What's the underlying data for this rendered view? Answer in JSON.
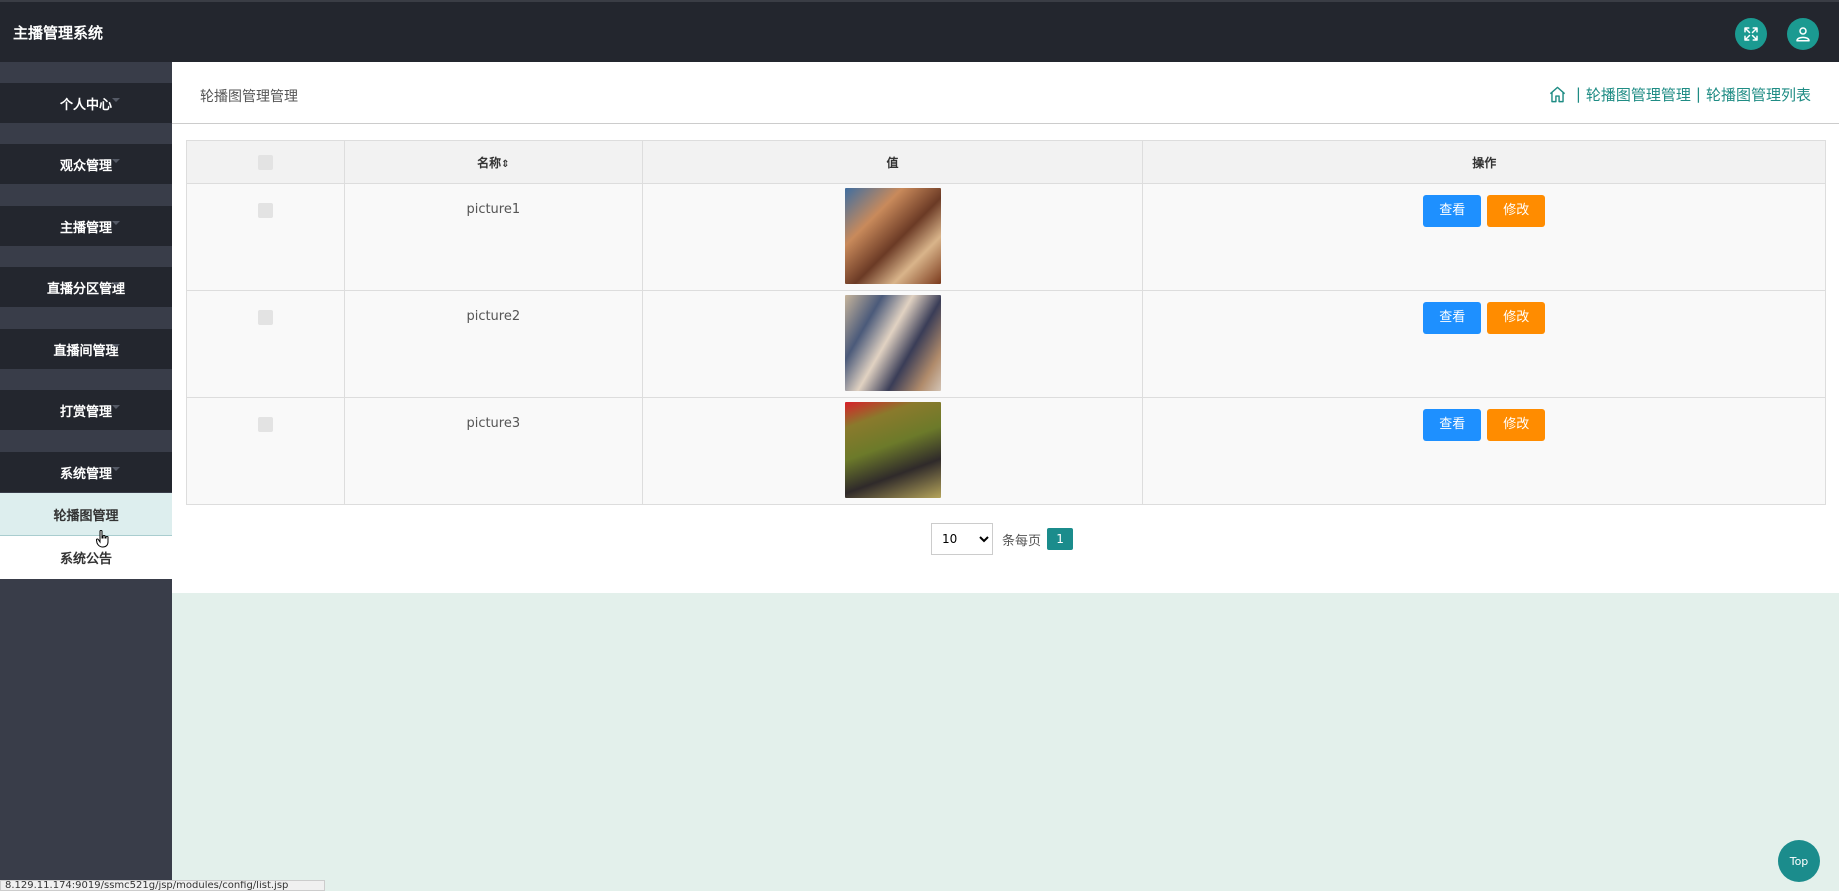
{
  "header": {
    "app_title": "主播管理系统",
    "fullscreen_icon": "expand-icon",
    "user_icon": "user-icon"
  },
  "sidebar": {
    "items": [
      {
        "label": "个人中心"
      },
      {
        "label": "观众管理"
      },
      {
        "label": "主播管理"
      },
      {
        "label": "直播分区管理"
      },
      {
        "label": "直播间管理"
      },
      {
        "label": "打赏管理"
      },
      {
        "label": "系统管理"
      }
    ],
    "sub_items": [
      {
        "label": "轮播图管理",
        "active": true
      },
      {
        "label": "系统公告",
        "active": false
      }
    ]
  },
  "main": {
    "page_title": "轮播图管理管理",
    "breadcrumb": [
      "轮播图管理管理",
      "轮播图管理列表"
    ],
    "breadcrumb_sep": "|",
    "table": {
      "columns": [
        "名称",
        "值",
        "操作"
      ],
      "sort_glyph": "⇕",
      "rows": [
        {
          "name": "picture1",
          "image": "thumbnail"
        },
        {
          "name": "picture2",
          "image": "thumbnail"
        },
        {
          "name": "picture3",
          "image": "thumbnail"
        }
      ],
      "view_label": "查看",
      "edit_label": "修改"
    },
    "pager": {
      "page_size": "10",
      "page_size_options": [
        "10"
      ],
      "per_page_label": "条每页",
      "current_page": "1"
    }
  },
  "top_button": "Top",
  "status_url": "8.129.11.174:9019/ssmc521g/jsp/modules/config/list.jsp",
  "colors": {
    "header_bg": "#23262e",
    "sidebar_bg": "#393d49",
    "accent": "#1b9a91",
    "view_button": "#1e90ff",
    "edit_button": "#ff8c00",
    "page_bg": "#e3f0eb"
  }
}
